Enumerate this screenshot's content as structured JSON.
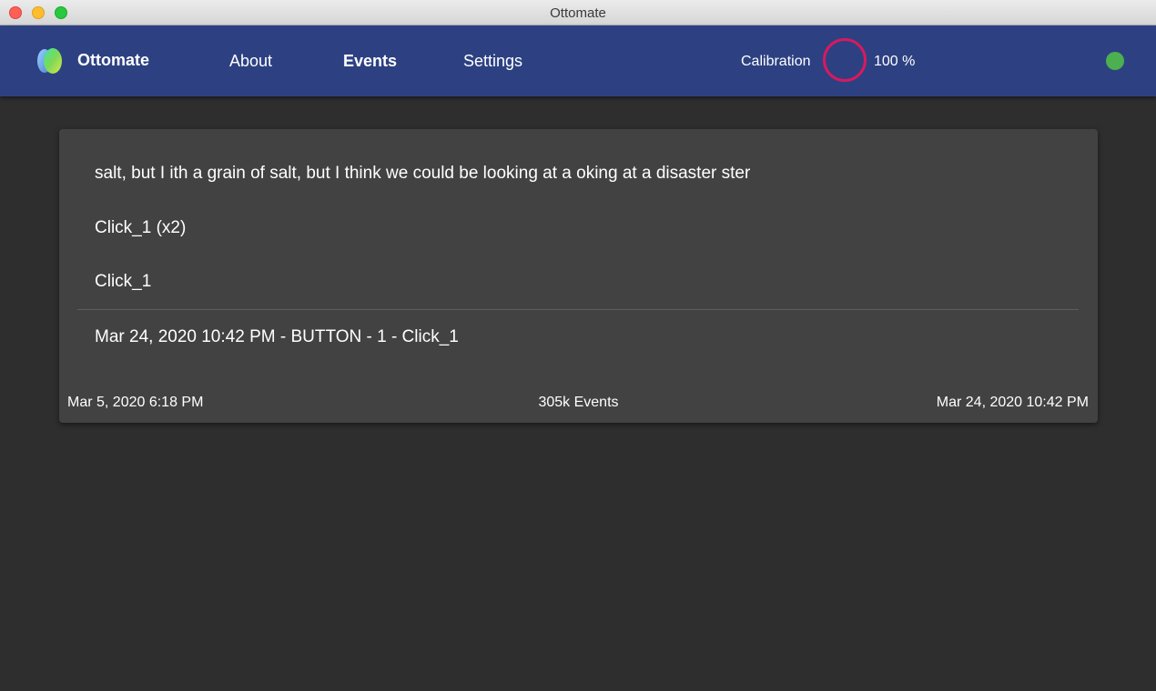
{
  "window": {
    "title": "Ottomate"
  },
  "navbar": {
    "brand": "Ottomate",
    "items": [
      {
        "label": "About",
        "active": false
      },
      {
        "label": "Events",
        "active": true
      },
      {
        "label": "Settings",
        "active": false
      }
    ],
    "calibration": {
      "label": "Calibration",
      "value": "100 %",
      "ring_color": "#d8195f"
    },
    "status_color": "#4caf50"
  },
  "events": {
    "lines": [
      "salt, but I ith a grain of salt, but I think we could be looking at a oking at a disaster ster",
      "Click_1 (x2)",
      "Click_1"
    ],
    "latest": "Mar 24, 2020 10:42 PM - BUTTON - 1 - Click_1",
    "footer": {
      "start": "Mar 5, 2020 6:18 PM",
      "count": "305k Events",
      "end": "Mar 24, 2020 10:42 PM"
    }
  },
  "colors": {
    "navbar": "#2d4182",
    "background": "#2e2e2e",
    "card": "#424242"
  }
}
